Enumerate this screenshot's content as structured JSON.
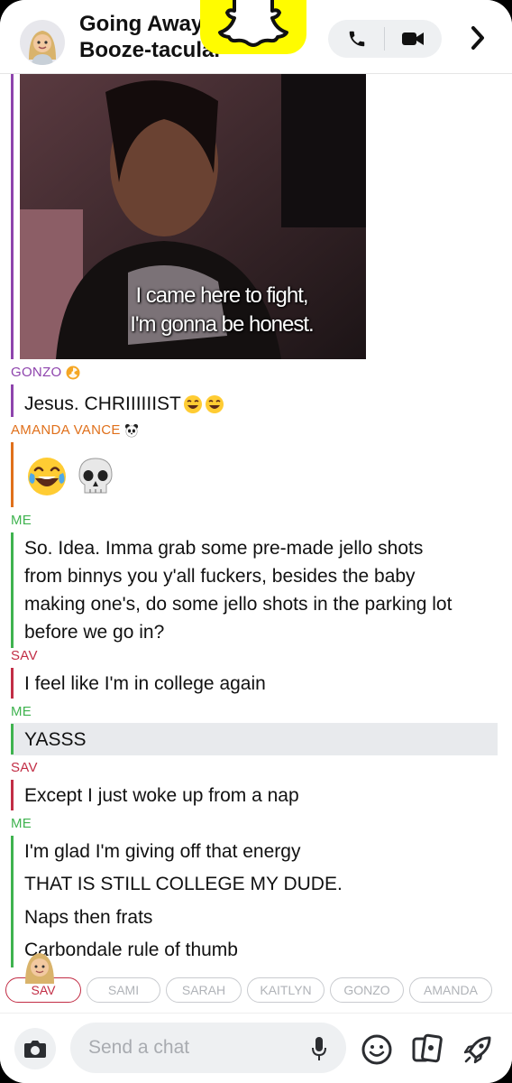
{
  "header": {
    "title_line1": "Going Away",
    "title_line2": "Booze-tacular",
    "icons": [
      "avatar",
      "snapchat-ghost-icon",
      "phone-icon",
      "video-icon",
      "chevron-right-icon"
    ]
  },
  "media": {
    "gif_caption_line1": "I came here to fight,",
    "gif_caption_line2": "I'm gonna be honest."
  },
  "messages": [
    {
      "sender": "GONZO",
      "text": "Jesus. CHRIIIIIIST"
    },
    {
      "sender": "AMANDA VANCE",
      "text": ""
    },
    {
      "sender": "ME",
      "lines": [
        "So. Idea. Imma grab some pre-made jello shots",
        "from binnys you y'all fuckers, besides the baby",
        "making one's, do some jello shots in the parking lot",
        "before we go in?"
      ]
    },
    {
      "sender": "SAV",
      "text": "I feel like I'm in college again"
    },
    {
      "sender": "ME",
      "text": "YASSS"
    },
    {
      "sender": "SAV",
      "text": "Except I just woke up from a nap"
    },
    {
      "sender": "ME",
      "lines": [
        "I'm glad I'm giving off that energy",
        "THAT IS STILL COLLEGE MY DUDE.",
        "Naps then frats",
        "Carbondale rule of thumb"
      ]
    }
  ],
  "colors": {
    "gonzo": "#8e44ad",
    "amanda": "#e0701b",
    "me": "#3fb34f",
    "sav": "#c22d45",
    "snap_yellow": "#fffc00"
  },
  "chips": [
    "SAV",
    "SAMI",
    "SARAH",
    "KAITLYN",
    "GONZO",
    "AMANDA"
  ],
  "active_chip": "SAV",
  "composer": {
    "placeholder": "Send a chat"
  }
}
